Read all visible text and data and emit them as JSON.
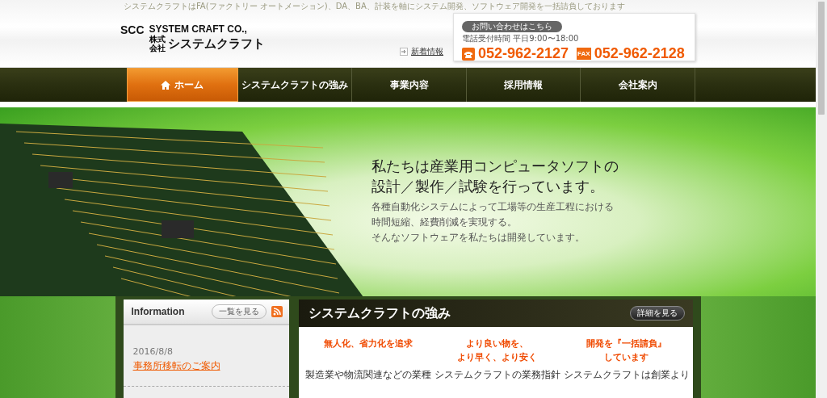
{
  "tagline": "システムクラフトはFA(ファクトリー オートメーション)、DA、BA、計装を軸にシステム開発、ソフトウェア開発を一括請負しております",
  "logo": {
    "abbr": "SCC",
    "name_en": "SYSTEM CRAFT CO.,",
    "corp": "株式会社",
    "name_ja": "システムクラフト"
  },
  "news_link": "新着情報",
  "contact": {
    "badge": "お問い合わせはこちら",
    "hours": "電話受付時間 平日9:00〜18:00",
    "phone": "052-962-2127",
    "fax_label": "FAX",
    "fax": "052-962-2128"
  },
  "nav": [
    {
      "label": "ホーム",
      "selected": true
    },
    {
      "label": "システムクラフトの強み",
      "selected": false
    },
    {
      "label": "事業内容",
      "selected": false
    },
    {
      "label": "採用情報",
      "selected": false
    },
    {
      "label": "会社案内",
      "selected": false
    }
  ],
  "hero": {
    "headline": [
      "私たちは産業用コンピュータソフトの",
      "設計／製作／試験を行っています。"
    ],
    "body": [
      "各種自動化システムによって工場等の生産工程における",
      "時間短縮、経費削減を実現する。",
      "そんなソフトウェアを私たちは開発しています。"
    ]
  },
  "information": {
    "title": "Information",
    "more": "一覧を見る",
    "items": [
      {
        "date": "2016/8/8",
        "title": "事務所移転のご案内"
      }
    ]
  },
  "strengths": {
    "title": "システムクラフトの強み",
    "more": "詳細を見る",
    "columns": [
      {
        "heading": [
          "無人化、省力化を追求"
        ],
        "text": "製造業や物流関連などの業種"
      },
      {
        "heading": [
          "より良い物を、",
          "より早く、より安く"
        ],
        "text": "システムクラフトの業務指針"
      },
      {
        "heading": [
          "開発を『一括請負』",
          "しています"
        ],
        "text": "システムクラフトは創業より"
      }
    ]
  }
}
